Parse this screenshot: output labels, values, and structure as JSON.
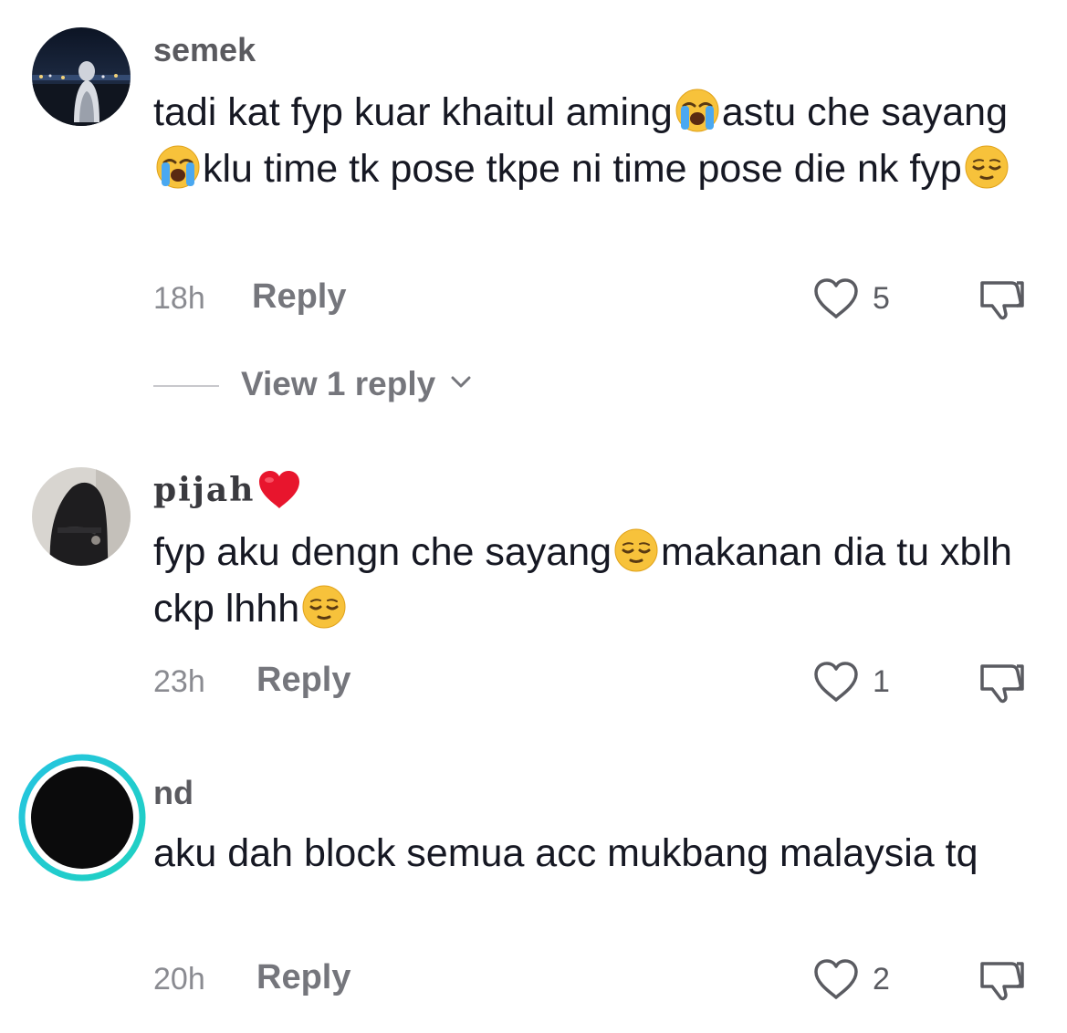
{
  "comments": [
    {
      "username": "semek",
      "segments": [
        {
          "text": "tadi kat fyp kuar khaitul aming"
        },
        {
          "emoji": "loudly-crying-face"
        },
        {
          "text": "astu che sayang"
        },
        {
          "emoji": "loudly-crying-face"
        },
        {
          "text": "klu time tk pose tkpe ni time pose die nk fyp"
        },
        {
          "emoji": "relieved-face"
        }
      ],
      "time": "18h",
      "reply_label": "Reply",
      "likes": "5",
      "view_replies": "View 1 reply"
    },
    {
      "username": "pijah",
      "username_emoji": "red-heart",
      "segments": [
        {
          "text": "fyp aku dengn che sayang"
        },
        {
          "emoji": "relieved-face"
        },
        {
          "text": "makanan dia tu xblh ckp lhhh"
        },
        {
          "emoji": "relieved-face"
        }
      ],
      "time": "23h",
      "reply_label": "Reply",
      "likes": "1"
    },
    {
      "username": "nd",
      "segments": [
        {
          "text": "aku dah block semua acc mukbang malaysia tq"
        }
      ],
      "time": "20h",
      "reply_label": "Reply",
      "likes": "2"
    }
  ],
  "icons": {
    "like": "heart-outline-icon",
    "dislike": "thumbs-down-outline-icon",
    "expand": "chevron-down-icon"
  },
  "colors": {
    "text": "#161823",
    "muted": "#8a8b91",
    "story_ring_start": "#25c4e0",
    "story_ring_end": "#1fd1c1"
  }
}
